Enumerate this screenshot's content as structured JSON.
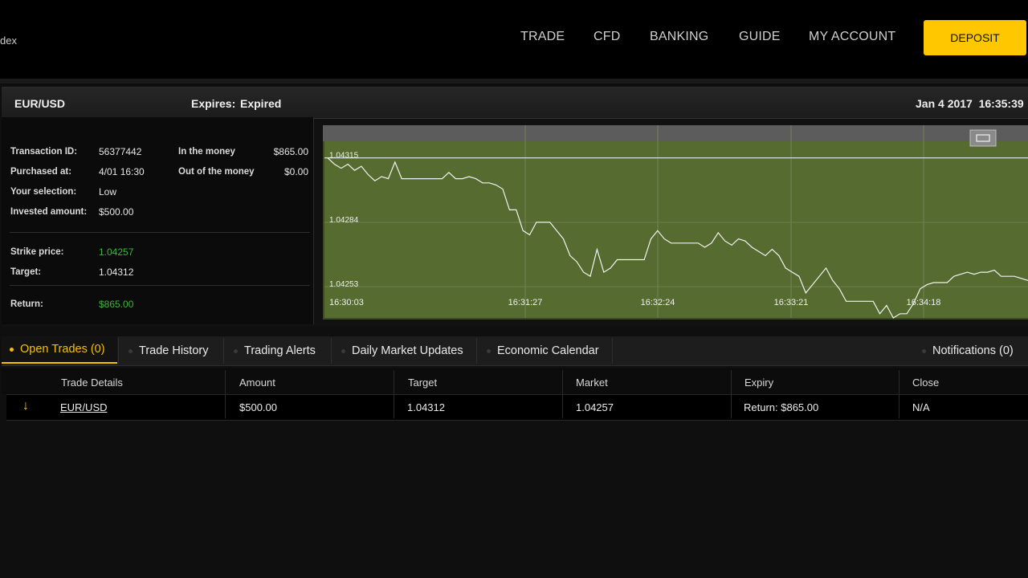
{
  "brand_text": "dex",
  "nav": {
    "trade": "TRADE",
    "cfd": "CFD",
    "banking": "BANKING",
    "guide": "GUIDE",
    "my_account": "MY ACCOUNT",
    "deposit": "DEPOSIT"
  },
  "trade_panel": {
    "asset": "EUR/USD",
    "expires_label": "Expires:",
    "expires_value": "Expired",
    "datetime": "Jan 4 2017  16:35:39"
  },
  "details": {
    "transaction_id_label": "Transaction ID:",
    "transaction_id": "56377442",
    "purchased_label": "Purchased at:",
    "purchased": "4/01 16:30",
    "selection_label": "Your selection:",
    "selection": "Low",
    "invested_label": "Invested amount:",
    "invested": "$500.00",
    "in_money_label": "In the money",
    "in_money": "$865.00",
    "out_money_label": "Out of the money",
    "out_money": "$0.00",
    "strike_label": "Strike price:",
    "strike": "1.04257",
    "target_label": "Target:",
    "target": "1.04312",
    "return_label": "Return:",
    "return": "$865.00"
  },
  "chart_data": {
    "type": "line",
    "y_ticks": [
      "1.04315",
      "1.04284",
      "1.04253"
    ],
    "ylim": [
      1.04238,
      1.04323
    ],
    "x_ticks": [
      "16:30:03",
      "16:31:27",
      "16:32:24",
      "16:33:21",
      "16:34:18"
    ],
    "background": "#556b2f",
    "target_line": 1.04315,
    "values": [
      1.04315,
      1.04312,
      1.0431,
      1.04312,
      1.04309,
      1.04311,
      1.04307,
      1.04304,
      1.04306,
      1.04305,
      1.04313,
      1.04305,
      1.04305,
      1.04305,
      1.04305,
      1.04305,
      1.04305,
      1.04305,
      1.04308,
      1.04305,
      1.04305,
      1.04306,
      1.04305,
      1.04303,
      1.04303,
      1.04302,
      1.043,
      1.0429,
      1.0429,
      1.0428,
      1.04278,
      1.04284,
      1.04284,
      1.04284,
      1.0428,
      1.04276,
      1.04268,
      1.04265,
      1.0426,
      1.04258,
      1.04271,
      1.0426,
      1.04262,
      1.04266,
      1.04266,
      1.04266,
      1.04266,
      1.04266,
      1.04276,
      1.0428,
      1.04276,
      1.04274,
      1.04274,
      1.04274,
      1.04274,
      1.04274,
      1.04272,
      1.04274,
      1.04279,
      1.04275,
      1.04273,
      1.04276,
      1.04275,
      1.04272,
      1.0427,
      1.04268,
      1.04271,
      1.04268,
      1.04262,
      1.0426,
      1.04258,
      1.0425,
      1.04254,
      1.04258,
      1.04262,
      1.04256,
      1.04252,
      1.04246,
      1.04246,
      1.04246,
      1.04246,
      1.04246,
      1.0424,
      1.04244,
      1.04238,
      1.0424,
      1.0424,
      1.04245,
      1.04252,
      1.04254,
      1.04255,
      1.04255,
      1.04255,
      1.04258,
      1.04259,
      1.0426,
      1.04259,
      1.0426,
      1.0426,
      1.04261,
      1.04258,
      1.04258,
      1.04258,
      1.04257,
      1.04256
    ]
  },
  "tabs": {
    "open_trades": "Open Trades (0)",
    "trade_history": "Trade History",
    "trading_alerts": "Trading Alerts",
    "daily_updates": "Daily Market Updates",
    "economic_calendar": "Economic Calendar",
    "notifications": "Notifications (0)"
  },
  "table": {
    "headers": {
      "details": "Trade Details",
      "amount": "Amount",
      "target": "Target",
      "market": "Market",
      "expiry": "Expiry",
      "close": "Close"
    },
    "row": {
      "direction": "↓",
      "asset": "EUR/USD",
      "amount": "$500.00",
      "target": "1.04312",
      "market": "1.04257",
      "expiry": "Return: $865.00",
      "close": "N/A"
    }
  }
}
